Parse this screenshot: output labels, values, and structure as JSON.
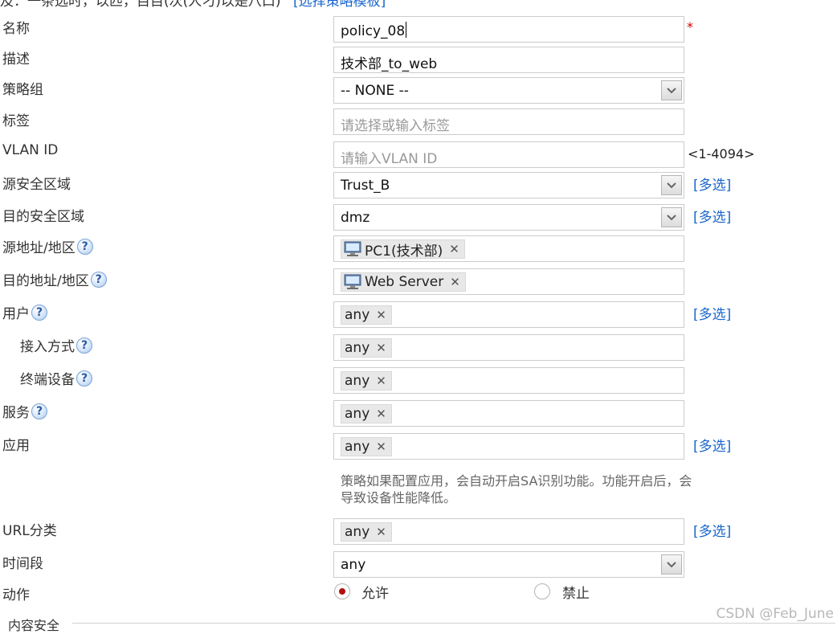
{
  "top_text": {
    "prefix": "及：一条选时，以匹，目目(次(人刁)以是八口)",
    "link": "[选择策略模板]"
  },
  "fields": {
    "name": {
      "label": "名称",
      "value": "policy_08",
      "required_mark": "*"
    },
    "desc": {
      "label": "描述",
      "value": "技术部_to_web"
    },
    "group": {
      "label": "策略组",
      "value": "-- NONE --"
    },
    "tag": {
      "label": "标签",
      "placeholder": "请选择或输入标签"
    },
    "vlan": {
      "label": "VLAN ID",
      "placeholder": "请输入VLAN ID",
      "range": "<1-4094>"
    },
    "src_zone": {
      "label": "源安全区域",
      "value": "Trust_B",
      "multi": "[多选]"
    },
    "dst_zone": {
      "label": "目的安全区域",
      "value": "dmz",
      "multi": "[多选]"
    },
    "src_addr": {
      "label": "源地址/地区",
      "chip": "PC1(技术部)"
    },
    "dst_addr": {
      "label": "目的地址/地区",
      "chip": "Web Server"
    },
    "user": {
      "label": "用户",
      "chip": "any",
      "multi": "[多选]"
    },
    "access": {
      "label": "接入方式",
      "chip": "any"
    },
    "terminal": {
      "label": "终端设备",
      "chip": "any"
    },
    "service": {
      "label": "服务",
      "chip": "any"
    },
    "app": {
      "label": "应用",
      "chip": "any",
      "multi": "[多选]",
      "note": "策略如果配置应用，会自动开启SA识别功能。功能开启后，会导致设备性能降低。"
    },
    "url": {
      "label": "URL分类",
      "chip": "any",
      "multi": "[多选]"
    },
    "time": {
      "label": "时间段",
      "value": "any"
    },
    "action": {
      "label": "动作",
      "allow": "允许",
      "deny": "禁止",
      "selected": "allow"
    }
  },
  "help_glyph": "?",
  "remove_glyph": "✕",
  "section_legend": "内容安全",
  "watermark": "CSDN @Feb_June",
  "colors": {
    "link": "#1a66cc",
    "required": "#d00000",
    "radio_selected": "#b01010",
    "border": "#cccccc",
    "chip_bg": "#e8e8e8"
  },
  "icons": [
    "help-icon",
    "remove-icon",
    "dropdown-arrow-icon",
    "computer-icon"
  ]
}
